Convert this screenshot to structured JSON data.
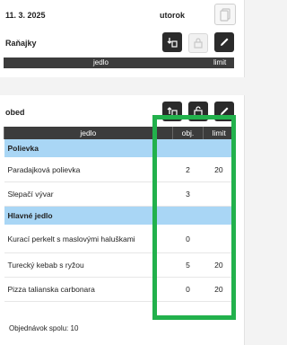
{
  "day": {
    "date": "11. 3. 2025",
    "weekday": "utorok"
  },
  "breakfast": {
    "title": "Raňajky",
    "columns": {
      "food": "jedlo",
      "limit": "limit"
    }
  },
  "lunch": {
    "title": "obed",
    "columns": {
      "food": "jedlo",
      "orders": "obj.",
      "limit": "limit"
    },
    "rows": [
      {
        "type": "category",
        "name": "Polievka"
      },
      {
        "type": "item",
        "name": "Paradajková polievka",
        "orders": "2",
        "limit": "20"
      },
      {
        "type": "item",
        "name": "Slepačí vývar",
        "orders": "3",
        "limit": ""
      },
      {
        "type": "category",
        "name": "Hlavné jedlo"
      },
      {
        "type": "item",
        "name": "Kurací perkelt s maslovými haluškami",
        "orders": "0",
        "limit": ""
      },
      {
        "type": "item",
        "name": "Turecký kebab s ryžou",
        "orders": "5",
        "limit": "20"
      },
      {
        "type": "item",
        "name": "Pizza talianska carbonara",
        "orders": "0",
        "limit": "20"
      }
    ],
    "total_label": "Objednávok spolu:",
    "total_value": "10"
  },
  "icons": [
    "copy-icon",
    "import-icon",
    "lock-icon",
    "edit-icon",
    "export-icon",
    "unlock-icon"
  ],
  "colors": {
    "header": "#3c3c3c",
    "category": "#a9d6f5",
    "highlight": "#22b14c"
  }
}
